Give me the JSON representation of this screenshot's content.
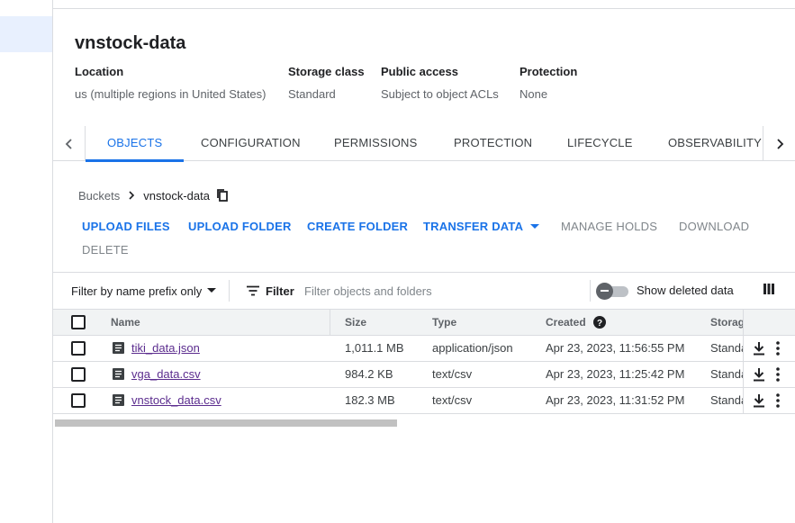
{
  "bucket": {
    "title": "vnstock-data",
    "info": [
      {
        "label": "Location",
        "value": "us (multiple regions in United States)"
      },
      {
        "label": "Storage class",
        "value": "Standard"
      },
      {
        "label": "Public access",
        "value": "Subject to object ACLs"
      },
      {
        "label": "Protection",
        "value": "None"
      }
    ]
  },
  "tabs": [
    {
      "label": "OBJECTS",
      "active": true
    },
    {
      "label": "CONFIGURATION"
    },
    {
      "label": "PERMISSIONS"
    },
    {
      "label": "PROTECTION"
    },
    {
      "label": "LIFECYCLE"
    },
    {
      "label": "OBSERVABILITY"
    }
  ],
  "breadcrumb": {
    "root": "Buckets",
    "current": "vnstock-data"
  },
  "actions": {
    "upload_files": "UPLOAD FILES",
    "upload_folder": "UPLOAD FOLDER",
    "create_folder": "CREATE FOLDER",
    "transfer_data": "TRANSFER DATA",
    "manage_holds": "MANAGE HOLDS",
    "download": "DOWNLOAD",
    "delete": "DELETE"
  },
  "filterbar": {
    "prefix_label": "Filter by name prefix only",
    "filter_label": "Filter",
    "placeholder": "Filter objects and folders",
    "show_deleted_label": "Show deleted data"
  },
  "table": {
    "columns": {
      "name": "Name",
      "size": "Size",
      "type": "Type",
      "created": "Created",
      "storage": "Storag"
    },
    "rows": [
      {
        "name": "tiki_data.json",
        "size": "1,011.1 MB",
        "type": "application/json",
        "created": "Apr 23, 2023, 11:56:55 PM",
        "storage": "Standa"
      },
      {
        "name": "vga_data.csv",
        "size": "984.2 KB",
        "type": "text/csv",
        "created": "Apr 23, 2023, 11:25:42 PM",
        "storage": "Standa"
      },
      {
        "name": "vnstock_data.csv",
        "size": "182.3 MB",
        "type": "text/csv",
        "created": "Apr 23, 2023, 11:31:52 PM",
        "storage": "Standa"
      }
    ]
  },
  "colors": {
    "accent": "#1a73e8",
    "visited_link": "#5b2c8e"
  }
}
